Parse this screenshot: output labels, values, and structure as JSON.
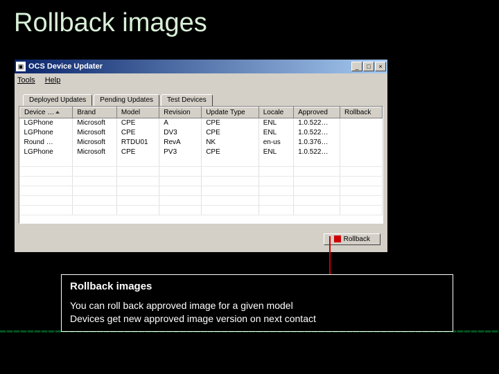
{
  "slide": {
    "title": "Rollback images"
  },
  "window": {
    "title": "OCS Device Updater",
    "menus": {
      "tools": "Tools",
      "help": "Help"
    },
    "tabs": {
      "deployed": "Deployed Updates",
      "pending": "Pending Updates",
      "test": "Test Devices"
    },
    "columns": {
      "device": "Device …",
      "brand": "Brand",
      "model": "Model",
      "revision": "Revision",
      "updateType": "Update Type",
      "locale": "Locale",
      "approved": "Approved",
      "rollback": "Rollback"
    },
    "rows": [
      {
        "device": "LGPhone",
        "brand": "Microsoft",
        "model": "CPE",
        "revision": "A",
        "updateType": "CPE",
        "locale": "ENL",
        "approved": "1.0.522…",
        "rollback": ""
      },
      {
        "device": "LGPhone",
        "brand": "Microsoft",
        "model": "CPE",
        "revision": "DV3",
        "updateType": "CPE",
        "locale": "ENL",
        "approved": "1.0.522…",
        "rollback": ""
      },
      {
        "device": "Round …",
        "brand": "Microsoft",
        "model": "RTDU01",
        "revision": "RevA",
        "updateType": "NK",
        "locale": "en-us",
        "approved": "1.0.376…",
        "rollback": ""
      },
      {
        "device": "LGPhone",
        "brand": "Microsoft",
        "model": "CPE",
        "revision": "PV3",
        "updateType": "CPE",
        "locale": "ENL",
        "approved": "1.0.522…",
        "rollback": ""
      }
    ],
    "buttons": {
      "rollback": "Rollback",
      "minimize": "_",
      "maximize": "□",
      "close": "×"
    }
  },
  "callout": {
    "title": "Rollback images",
    "line1": "You can roll back approved image for a given model",
    "line2": "Devices get new approved image version on next contact"
  }
}
